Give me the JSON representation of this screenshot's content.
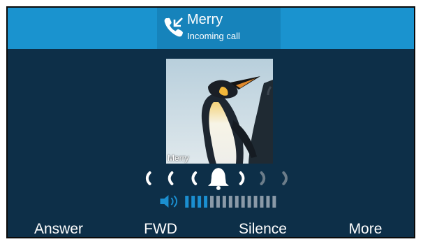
{
  "call": {
    "caller_name": "Merry",
    "status": "Incoming call",
    "photo_label": "Merry"
  },
  "ringer": {
    "icon": "bell-icon",
    "wave_icon": "ring-wave-icon"
  },
  "volume": {
    "icon": "speaker-icon",
    "level": 4,
    "max": 15,
    "active_color": "#1b8fd0",
    "inactive_color": "#8a9aa8"
  },
  "softkeys": [
    {
      "label": "Answer",
      "selected": true
    },
    {
      "label": "FWD"
    },
    {
      "label": "Silence"
    },
    {
      "label": "More"
    }
  ],
  "colors": {
    "screen_background": "#0d2f48",
    "top_bar": "#1a93cf",
    "caller_box": "#1683bb",
    "selected_underline": "#31c339"
  }
}
